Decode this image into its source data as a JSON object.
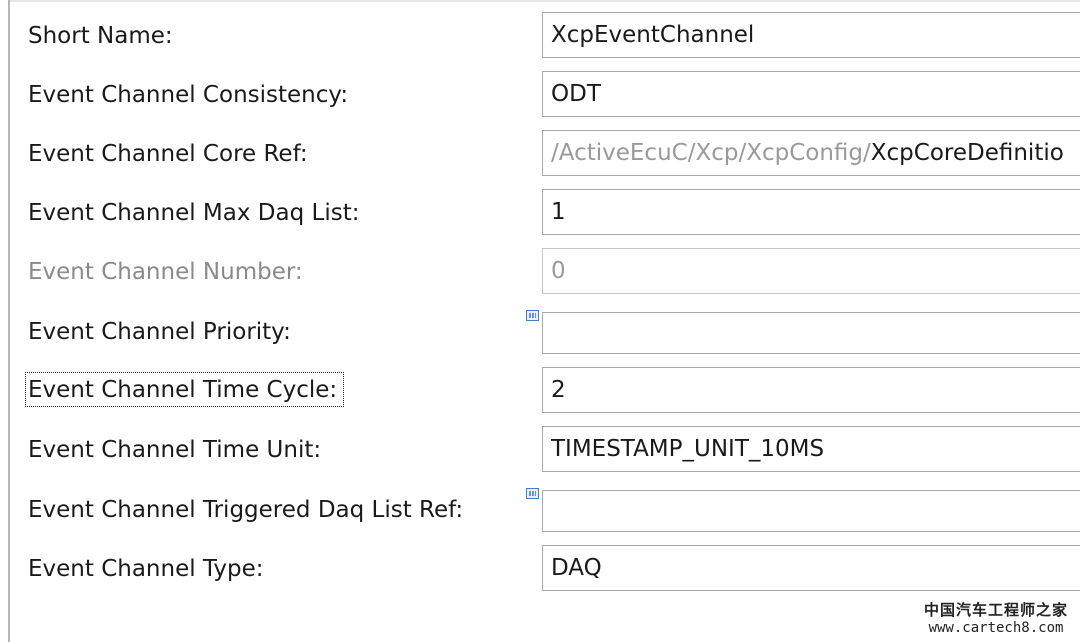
{
  "rows": [
    {
      "label": "Short Name:",
      "value": "XcpEventChannel"
    },
    {
      "label": "Event Channel Consistency:",
      "value": "ODT"
    },
    {
      "label": "Event Channel Core Ref:",
      "value_prefix": "/ActiveEcuC/Xcp/XcpConfig/",
      "value_target": "XcpCoreDefinitio"
    },
    {
      "label": "Event Channel Max Daq List:",
      "value": "1"
    },
    {
      "label": "Event Channel Number:",
      "value": "0"
    },
    {
      "label": "Event Channel Priority:",
      "value": ""
    },
    {
      "label": "Event Channel Time Cycle:",
      "value": "2"
    },
    {
      "label": "Event Channel Time Unit:",
      "value": "TIMESTAMP_UNIT_10MS"
    },
    {
      "label": "Event Channel Triggered Daq List Ref:",
      "value": ""
    },
    {
      "label": "Event Channel Type:",
      "value": "DAQ"
    }
  ],
  "watermark": {
    "line1": "中国汽车工程师之家",
    "line2": "www.cartech8.com"
  }
}
